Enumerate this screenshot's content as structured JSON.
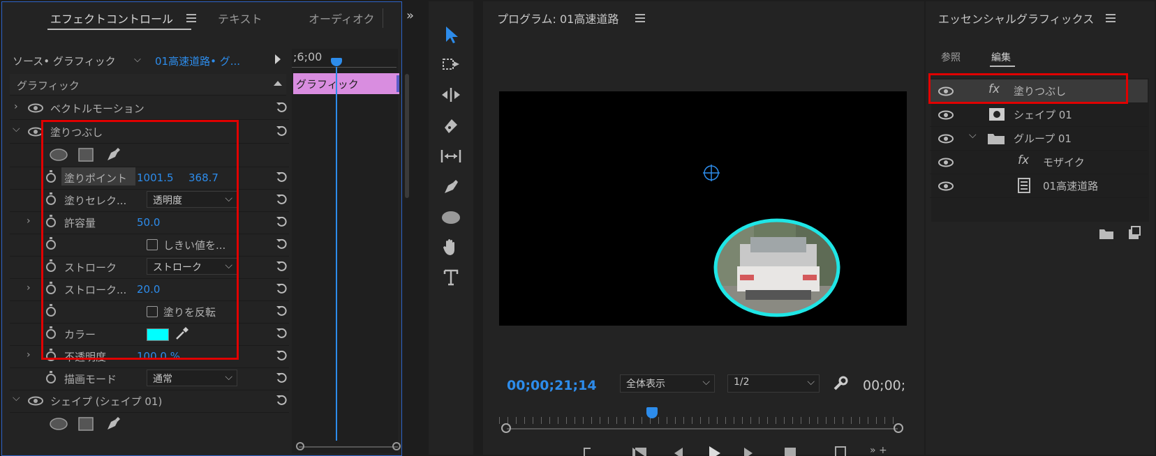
{
  "effect_controls": {
    "tabs": [
      "エフェクトコントロール",
      "テキスト",
      "オーディオク"
    ],
    "source_label": "ソース• グラフィック",
    "clip_label": "01高速道路• グ...",
    "timecode": ";6;00",
    "section": "グラフィック",
    "timeline_clip": "グラフィック",
    "rows": {
      "vector_motion": "ベクトルモーション",
      "fill_effect": "塗りつぶし",
      "fill_point_label": "塗りポイント",
      "fill_point_x": "1001.5",
      "fill_point_y": "368.7",
      "fill_select_label": "塗りセレク...",
      "fill_select_value": "透明度",
      "tolerance_label": "許容量",
      "tolerance_value": "50.0",
      "threshold_label": "しきい値を...",
      "stroke_label": "ストローク",
      "stroke_value": "ストローク",
      "stroke_width_label": "ストローク...",
      "stroke_width_value": "20.0",
      "invert_label": "塗りを反転",
      "color_label": "カラー",
      "opacity_label": "不透明度",
      "opacity_value": "100.0 %",
      "blend_label": "描画モード",
      "blend_value": "通常",
      "shape_label": "シェイプ (シェイプ 01)"
    },
    "fill_color": "#00ffff"
  },
  "program_monitor": {
    "title": "プログラム: 01高速道路",
    "timecode": "00;00;21;14",
    "zoom": "全体表示",
    "resolution": "1/2",
    "end_timecode": "00;00;"
  },
  "essential_graphics": {
    "title": "エッセンシャルグラフィックス",
    "tabs": [
      "参照",
      "編集"
    ],
    "layers": [
      "塗りつぶし",
      "シェイプ 01",
      "グループ 01",
      "モザイク",
      "01高速道路"
    ]
  },
  "colors": {
    "accent_blue": "#2d8ceb",
    "highlight_red": "#e00000",
    "ellipse_cyan": "#1fe6e6",
    "clip_pink": "#d98de0"
  }
}
